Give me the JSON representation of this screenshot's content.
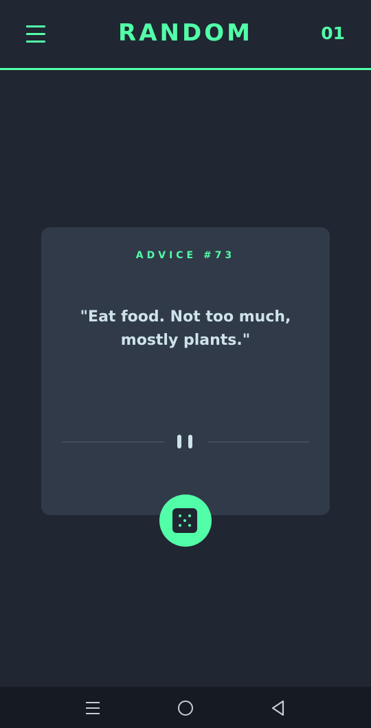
{
  "header": {
    "title": "RANDOM",
    "counter": "01",
    "menu_icon": "hamburger-menu-icon"
  },
  "card": {
    "label": "ADVICE #73",
    "quote": "\"Eat food. Not too much, mostly plants.\"",
    "divider_icon": "pause-icon"
  },
  "action": {
    "icon": "dice-icon"
  },
  "system_nav": {
    "recents_icon": "recents-icon",
    "home_icon": "home-icon",
    "back_icon": "back-icon"
  },
  "colors": {
    "accent": "#52ffa8",
    "background": "#202632",
    "card": "#313a49",
    "quote_text": "#cee3e9",
    "divider": "#4f5d74",
    "navbar": "#161a22"
  }
}
